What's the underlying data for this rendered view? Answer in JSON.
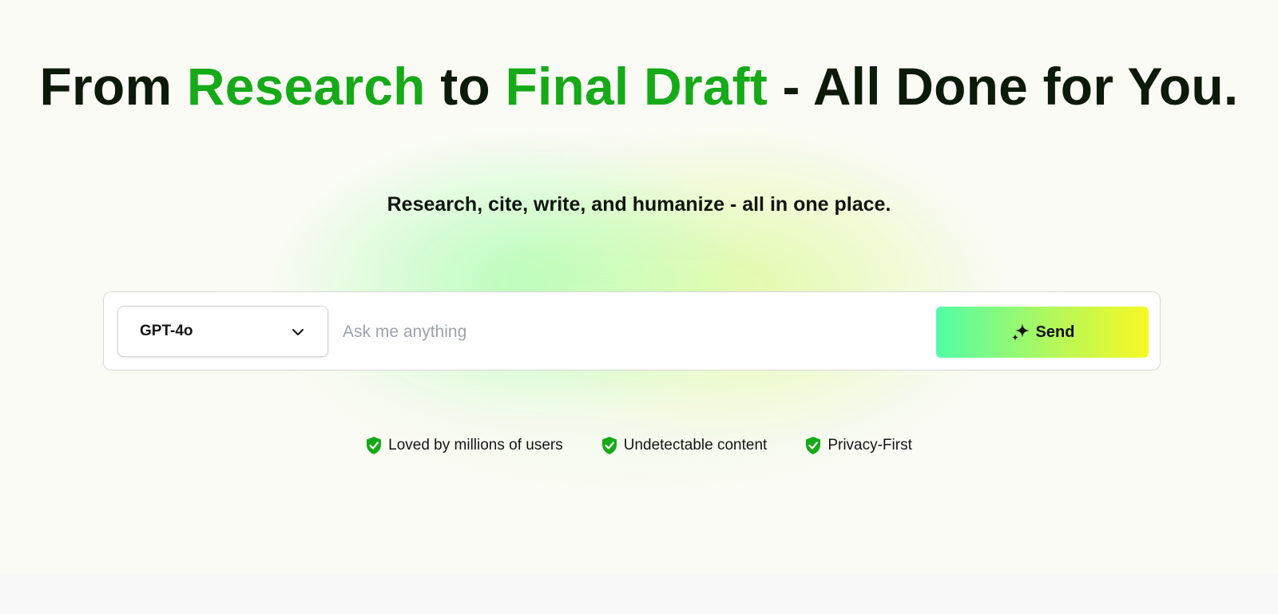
{
  "hero": {
    "headline": {
      "part1": "From ",
      "highlight1": "Research",
      "part2": " to ",
      "highlight2": "Final Draft",
      "part3": " - All Done for You."
    },
    "subtitle": "Research, cite, write, and humanize - all in one place."
  },
  "search": {
    "model_selected": "GPT-4o",
    "placeholder": "Ask me anything",
    "value": "",
    "send_label": "Send"
  },
  "features": [
    {
      "label": "Loved by millions of users",
      "icon": "shield-check-icon"
    },
    {
      "label": "Undetectable content",
      "icon": "shield-check-icon"
    },
    {
      "label": "Privacy-First",
      "icon": "shield-check-icon"
    }
  ],
  "colors": {
    "accent_green": "#16aa18",
    "headline_dark": "#0c1a0a",
    "send_gradient_start": "#52fca7",
    "send_gradient_end": "#f8f824",
    "placeholder_gray": "#9ca3af"
  }
}
